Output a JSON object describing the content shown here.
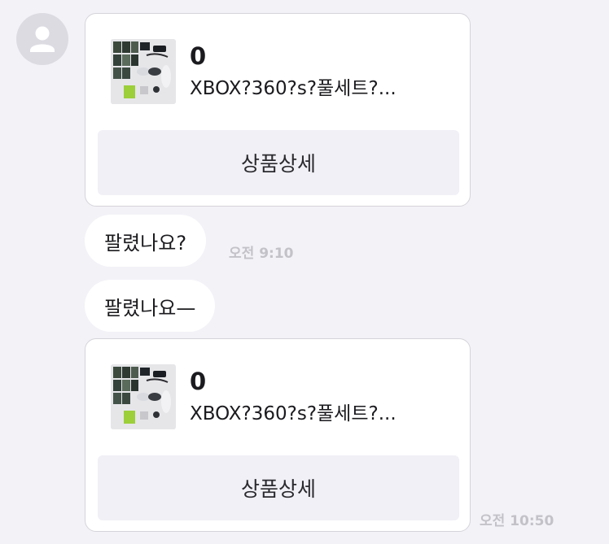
{
  "chat": {
    "messages": [
      {
        "type": "product",
        "price": "0",
        "title": "XBOX?360?s?풀세트?...",
        "detail_label": "상품상세",
        "thumbnail_icon": "xbox-bundle-photo"
      },
      {
        "type": "text",
        "text": "팔렸나요?",
        "time": "오전 9:10"
      },
      {
        "type": "text",
        "text": "팔렸나요—"
      },
      {
        "type": "product",
        "price": "0",
        "title": "XBOX?360?s?풀세트?...",
        "detail_label": "상품상세",
        "thumbnail_icon": "xbox-bundle-photo",
        "time": "오전 10:50"
      }
    ]
  },
  "colors": {
    "background": "#f3f2f7",
    "bubble": "#ffffff",
    "button": "#f1f0f6",
    "timestamp": "#c3c2c8",
    "avatar": "#dcdbe2"
  }
}
